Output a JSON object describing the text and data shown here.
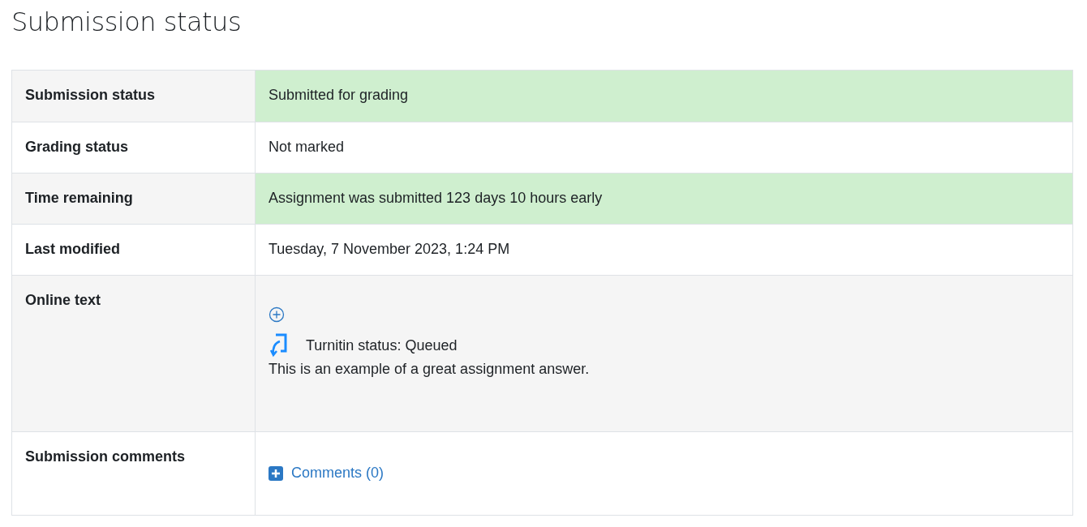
{
  "title": "Submission status",
  "rows": [
    {
      "label": "Submission status",
      "kind": "text",
      "value": "Submitted for grading",
      "highlighted": true
    },
    {
      "label": "Grading status",
      "kind": "text",
      "value": "Not marked",
      "highlighted": false
    },
    {
      "label": "Time remaining",
      "kind": "text",
      "value": "Assignment was submitted 123 days 10 hours early",
      "highlighted": true
    },
    {
      "label": "Last modified",
      "kind": "text",
      "value": "Tuesday, 7 November 2023, 1:24 PM",
      "highlighted": false
    },
    {
      "label": "Online text",
      "kind": "online_text",
      "status": "Turnitin status: Queued",
      "value": "This is an example of a great assignment answer.",
      "highlighted": false
    },
    {
      "label": "Submission comments",
      "kind": "comments",
      "link": "Comments (0)",
      "highlighted": false
    }
  ]
}
